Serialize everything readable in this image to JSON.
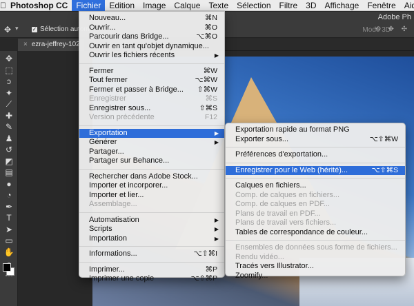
{
  "menubar": {
    "apple": "",
    "items": [
      {
        "label": "Photoshop CC",
        "active": false,
        "app": true
      },
      {
        "label": "Fichier",
        "active": true
      },
      {
        "label": "Edition"
      },
      {
        "label": "Image"
      },
      {
        "label": "Calque"
      },
      {
        "label": "Texte"
      },
      {
        "label": "Sélection"
      },
      {
        "label": "Filtre"
      },
      {
        "label": "3D"
      },
      {
        "label": "Affichage"
      },
      {
        "label": "Fenêtre"
      },
      {
        "label": "Aide"
      }
    ]
  },
  "options_bar": {
    "checkbox_mark": "✓",
    "auto_select_label": "Sélection autom",
    "window_title": "Adobe Ph",
    "mode_3d": "Mode 3D"
  },
  "document": {
    "tab_title": "ezra-jeffrey-102",
    "close_glyph": "×"
  },
  "file_menu": {
    "groups": [
      [
        {
          "label": "Nouveau...",
          "shortcut": "⌘N"
        },
        {
          "label": "Ouvrir...",
          "shortcut": "⌘O"
        },
        {
          "label": "Parcourir dans Bridge...",
          "shortcut": "⌥⌘O"
        },
        {
          "label": "Ouvrir en tant qu'objet dynamique...",
          "shortcut": ""
        },
        {
          "label": "Ouvrir les fichiers récents",
          "submenu": true
        }
      ],
      [
        {
          "label": "Fermer",
          "shortcut": "⌘W"
        },
        {
          "label": "Tout fermer",
          "shortcut": "⌥⌘W"
        },
        {
          "label": "Fermer et passer à Bridge...",
          "shortcut": "⇧⌘W"
        },
        {
          "label": "Enregistrer",
          "shortcut": "⌘S",
          "disabled": true
        },
        {
          "label": "Enregistrer sous...",
          "shortcut": "⇧⌘S"
        },
        {
          "label": "Version précédente",
          "shortcut": "F12",
          "disabled": true
        }
      ],
      [
        {
          "label": "Exportation",
          "submenu": true,
          "selected": true
        },
        {
          "label": "Générer",
          "submenu": true
        },
        {
          "label": "Partager..."
        },
        {
          "label": "Partager sur Behance..."
        }
      ],
      [
        {
          "label": "Rechercher dans Adobe Stock..."
        },
        {
          "label": "Importer et incorporer..."
        },
        {
          "label": "Importer et lier..."
        },
        {
          "label": "Assemblage...",
          "disabled": true
        }
      ],
      [
        {
          "label": "Automatisation",
          "submenu": true
        },
        {
          "label": "Scripts",
          "submenu": true
        },
        {
          "label": "Importation",
          "submenu": true
        }
      ],
      [
        {
          "label": "Informations...",
          "shortcut": "⌥⇧⌘I"
        }
      ],
      [
        {
          "label": "Imprimer...",
          "shortcut": "⌘P"
        },
        {
          "label": "Imprimer une copie",
          "shortcut": "⌥⇧⌘P"
        }
      ]
    ]
  },
  "export_submenu": {
    "groups": [
      [
        {
          "label": "Exportation rapide au format PNG"
        },
        {
          "label": "Exporter sous...",
          "shortcut": "⌥⇧⌘W"
        }
      ],
      [
        {
          "label": "Préférences d'exportation..."
        }
      ],
      [
        {
          "label": "Enregistrer pour le Web (hérité)...",
          "shortcut": "⌥⇧⌘S",
          "selected": true
        }
      ],
      [
        {
          "label": "Calques en fichiers..."
        },
        {
          "label": "Comp. de calques en fichiers...",
          "disabled": true
        },
        {
          "label": "Comp. de calques en PDF...",
          "disabled": true
        },
        {
          "label": "Plans de travail en PDF...",
          "disabled": true
        },
        {
          "label": "Plans de travail vers fichiers...",
          "disabled": true
        },
        {
          "label": "Tables de correspondance de couleur..."
        }
      ],
      [
        {
          "label": "Ensembles de données sous forme de fichiers...",
          "disabled": true
        },
        {
          "label": "Rendu vidéo...",
          "disabled": true
        },
        {
          "label": "Tracés vers Illustrator..."
        },
        {
          "label": "Zoomify..."
        }
      ]
    ]
  },
  "toolbox": {
    "tools": [
      {
        "name": "move-tool-icon",
        "glyph": "✥"
      },
      {
        "name": "marquee-tool-icon",
        "glyph": "⬚"
      },
      {
        "name": "lasso-tool-icon",
        "glyph": "ↄ"
      },
      {
        "name": "magic-wand-tool-icon",
        "glyph": "✦"
      },
      {
        "name": "eyedropper-tool-icon",
        "glyph": "⟋"
      },
      {
        "name": "healing-tool-icon",
        "glyph": "✚"
      },
      {
        "name": "brush-tool-icon",
        "glyph": "✎"
      },
      {
        "name": "stamp-tool-icon",
        "glyph": "♟"
      },
      {
        "name": "history-brush-icon",
        "glyph": "↺"
      },
      {
        "name": "eraser-tool-icon",
        "glyph": "◩"
      },
      {
        "name": "gradient-tool-icon",
        "glyph": "▤"
      },
      {
        "name": "blur-tool-icon",
        "glyph": "●"
      },
      {
        "name": "dodge-tool-icon",
        "glyph": "◔"
      },
      {
        "name": "pen-tool-icon",
        "glyph": "✒"
      },
      {
        "name": "type-tool-icon",
        "glyph": "T"
      },
      {
        "name": "path-selection-icon",
        "glyph": "➤"
      },
      {
        "name": "shape-tool-icon",
        "glyph": "▭"
      },
      {
        "name": "hand-tool-icon",
        "glyph": "✋"
      },
      {
        "name": "zoom-tool-icon",
        "glyph": "⌕"
      },
      {
        "name": "more-tools-icon",
        "glyph": "···"
      }
    ]
  },
  "colors": {
    "menu_highlight": "#2e6dd9",
    "menubar_active": "#2f6fdd",
    "ps_panel": "#3b3b3b"
  }
}
